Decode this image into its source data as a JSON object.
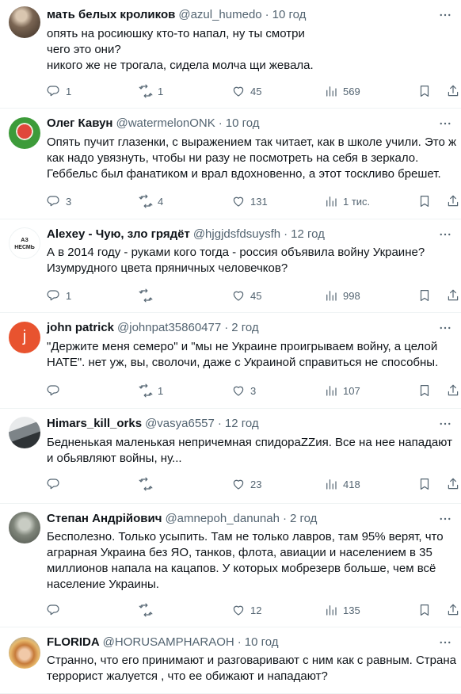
{
  "tweets": [
    {
      "name": "мать белых кроликов",
      "handle": "@azul_humedo",
      "sep": "·",
      "time": "10 год",
      "text": "опять на росиюшку кто-то напал, ну ты смотри\nчего это они?\nникого же не трогала, сидела молча щи жевала.",
      "replies": "1",
      "retweets": "1",
      "likes": "45",
      "views": "569",
      "avatar": {
        "bg": "#6b5a4a",
        "label": ""
      }
    },
    {
      "name": "Олег Кавун",
      "handle": "@watermelonONK",
      "sep": "·",
      "time": "10 год",
      "text": "Опять пучит глазенки, с выражением так читает, как в школе учили. Это ж как надо увязнуть, чтобы ни разу не посмотреть на себя в зеркало. Геббельс был фанатиком и врал вдохновенно, а этот тоскливо брешет.",
      "replies": "3",
      "retweets": "4",
      "likes": "131",
      "views": "1 тис.",
      "avatar": {
        "bg": "#3f8f3a",
        "label": ""
      }
    },
    {
      "name": "Alexey - Чую, зло грядёт",
      "handle": "@hjgjdsfdsuysfh",
      "sep": "·",
      "time": "12 год",
      "text": "А в 2014 году - руками кого тогда - россия объявила войну Украине? Изумрудного цвета пряничных человечков?",
      "replies": "1",
      "retweets": "",
      "likes": "45",
      "views": "998",
      "avatar": {
        "bg": "#ffffff",
        "label": "АЗ\nНЕСМЬ"
      }
    },
    {
      "name": "john patrick",
      "handle": "@johnpat35860477",
      "sep": "·",
      "time": "2 год",
      "text": "\"Держите меня семеро\" и \"мы не Украине проигрываем войну, а целой НАТЕ\". нет уж, вы, сволочи, даже с Украиной справиться не способны.",
      "replies": "",
      "retweets": "1",
      "likes": "3",
      "views": "107",
      "avatar": {
        "bg": "#e8532f",
        "label": "j"
      }
    },
    {
      "name": "Himars_kill_orks",
      "handle": "@vasya6557",
      "sep": "·",
      "time": "12 год",
      "text": "Бедненькая маленькая непричемная спидораZZия. Все на нее нападают и обьявляют войны, ну...",
      "replies": "",
      "retweets": "",
      "likes": "23",
      "views": "418",
      "avatar": {
        "bg": "#9ca3a8",
        "label": ""
      }
    },
    {
      "name": "Степан Андрійович",
      "handle": "@amnepoh_danunah",
      "sep": "·",
      "time": "2 год",
      "text": "Бесполезно. Только усыпить. Там не только лавров, там 95% верят, что аграрная Украина без ЯО, танков, флота, авиации и населением в 35 миллионов напала на кацапов. У которых мобрезерв больше, чем всё население Украины.",
      "replies": "",
      "retweets": "",
      "likes": "12",
      "views": "135",
      "avatar": {
        "bg": "#8a8f86",
        "label": ""
      }
    },
    {
      "name": "FLORIDA",
      "handle": "@HORUSAMPHARAOH",
      "sep": "·",
      "time": "10 год",
      "text": "Странно, что его принимают и разговаривают с ним как с равным. Страна террорист жалуется , что ее обижают и нападают?",
      "replies": "",
      "retweets": "",
      "likes": "",
      "views": "",
      "avatar": {
        "bg": "#c9a06a",
        "label": ""
      }
    }
  ],
  "colors": {
    "text": "#0f1419",
    "muted": "#536471",
    "border": "#eff3f4"
  },
  "icons": [
    "reply-icon",
    "retweet-icon",
    "like-icon",
    "views-icon",
    "bookmark-icon",
    "share-icon",
    "more-icon"
  ]
}
